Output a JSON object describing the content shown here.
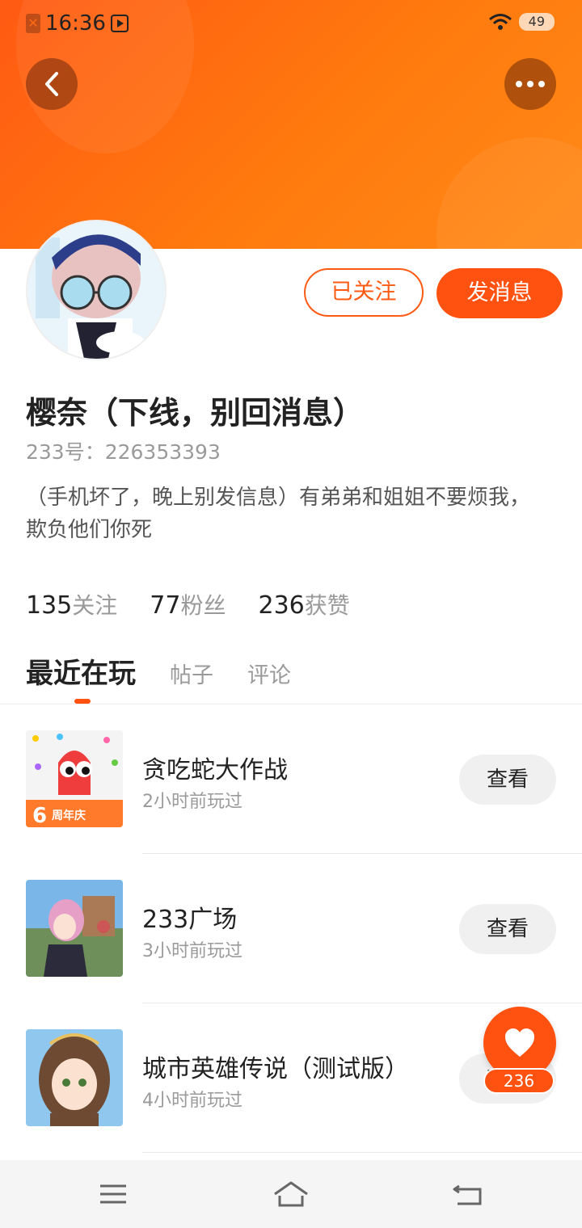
{
  "status_bar": {
    "time": "16:36",
    "battery": "49"
  },
  "header": {
    "back_icon": "back-chevron-icon",
    "more_icon": "more-dots-icon",
    "accent_color": "#ff6a14"
  },
  "profile": {
    "name": "樱奈（下线，别回消息）",
    "uid": "233号：226353393",
    "bio": "（手机坏了，晚上别发信息）有弟弟和姐姐不要烦我，欺负他们你死",
    "follow_button": "已关注",
    "message_button": "发消息"
  },
  "stats": [
    {
      "num": "135",
      "label": "关注"
    },
    {
      "num": "77",
      "label": "粉丝"
    },
    {
      "num": "236",
      "label": "获赞"
    }
  ],
  "tabs": {
    "active": "最近在玩",
    "posts": "帖子",
    "comments": "评论"
  },
  "games": [
    {
      "name": "贪吃蛇大作战",
      "time": "2小时前玩过",
      "button": "查看",
      "badge": "周年庆"
    },
    {
      "name": "233广场",
      "time": "3小时前玩过",
      "button": "查看"
    },
    {
      "name": "城市英雄传说（测试版）",
      "time": "4小时前玩过",
      "button": "查看"
    }
  ],
  "like_fab": {
    "count": "236",
    "icon": "heart-icon"
  },
  "nav_bar": {
    "menu_icon": "menu-icon",
    "home_icon": "home-icon",
    "back_icon": "return-icon"
  }
}
